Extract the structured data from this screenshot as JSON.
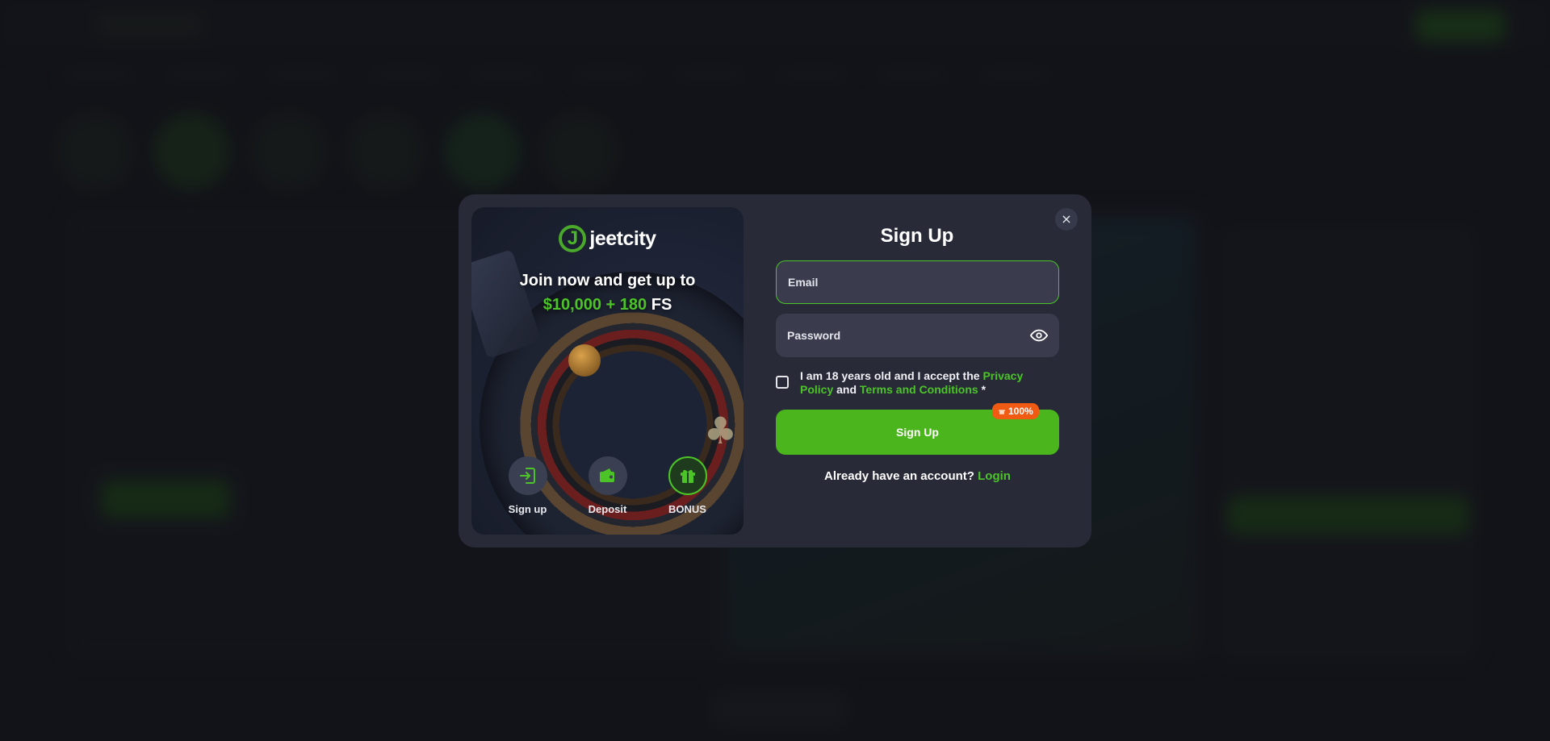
{
  "brand": {
    "name": "jeetcity",
    "accent": "#4cc428",
    "logo_letter": "J"
  },
  "promo": {
    "headline": "Join now and get up to",
    "amount": "$10,000 + 180",
    "suffix": "FS",
    "steps": [
      {
        "label": "Sign up",
        "icon": "login-arrow-icon"
      },
      {
        "label": "Deposit",
        "icon": "wallet-icon"
      },
      {
        "label": "BONUS",
        "icon": "gift-icon"
      }
    ]
  },
  "form": {
    "title": "Sign Up",
    "close_label": "×",
    "email_placeholder": "Email",
    "password_placeholder": "Password",
    "terms_prefix": "I am 18 years old and I accept the",
    "privacy_link": "Privacy Policy",
    "terms_and": "and",
    "terms_link": "Terms and Conditions",
    "required_mark": "*",
    "submit_label": "Sign Up",
    "badge": "100%",
    "login_prompt": "Already have an account?",
    "login_link": "Login"
  },
  "colors": {
    "primary_button": "#4bb51d",
    "badge": "#f05a12",
    "modal_bg": "#282a38",
    "field_bg": "#3a3c4e"
  }
}
